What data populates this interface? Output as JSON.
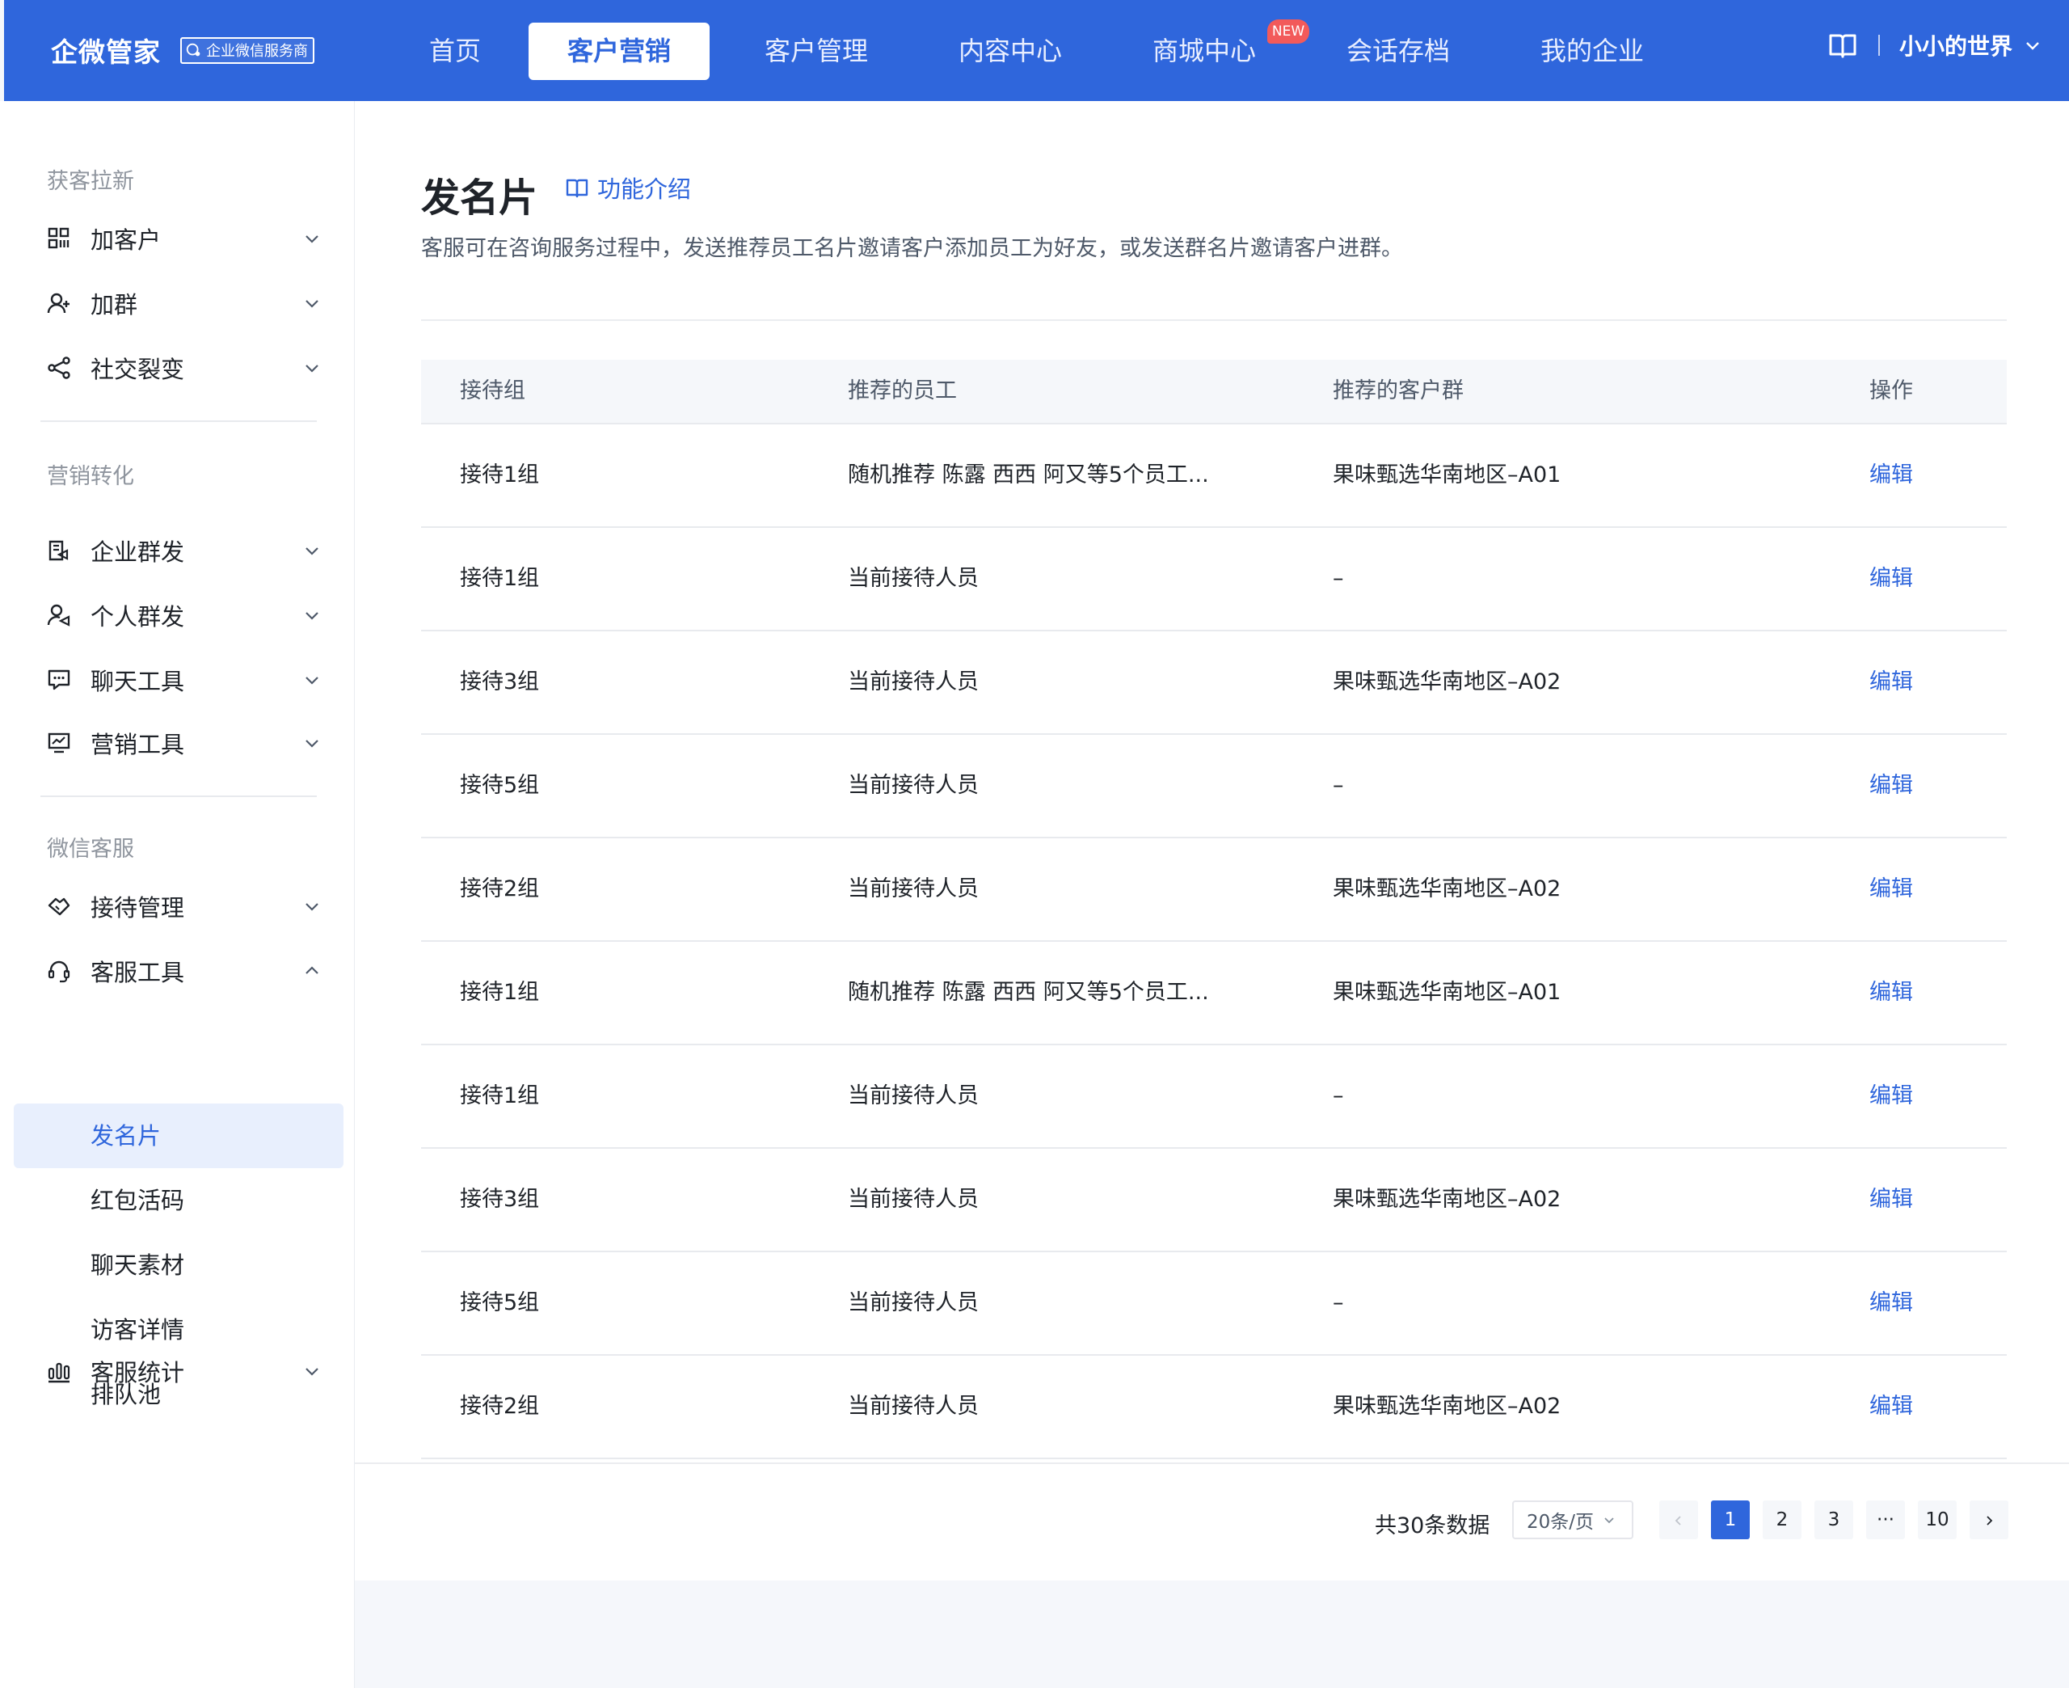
{
  "brand": {
    "name": "企微管家",
    "badge": "企业微信服务商"
  },
  "nav": {
    "items": [
      {
        "label": "首页"
      },
      {
        "label": "客户营销"
      },
      {
        "label": "客户管理"
      },
      {
        "label": "内容中心"
      },
      {
        "label": "商城中心"
      },
      {
        "label": "会话存档"
      },
      {
        "label": "我的企业"
      }
    ],
    "active": "客户营销",
    "new_badge": "NEW",
    "user": "小小的世界"
  },
  "sidebar": {
    "sections": [
      {
        "title": "获客拉新",
        "items": [
          {
            "label": "加客户"
          },
          {
            "label": "加群"
          },
          {
            "label": "社交裂变"
          }
        ]
      },
      {
        "title": "营销转化",
        "items": [
          {
            "label": "企业群发"
          },
          {
            "label": "个人群发"
          },
          {
            "label": "聊天工具"
          },
          {
            "label": "营销工具"
          }
        ]
      },
      {
        "title": "微信客服",
        "items": [
          {
            "label": "接待管理"
          },
          {
            "label": "客服工具"
          }
        ]
      }
    ],
    "sub_items": [
      {
        "label": "发名片"
      },
      {
        "label": "红包活码"
      },
      {
        "label": "聊天素材"
      },
      {
        "label": "访客详情"
      },
      {
        "label": "排队池"
      }
    ],
    "last_item": {
      "label": "客服统计"
    },
    "active_sub": "发名片"
  },
  "main": {
    "title": "发名片",
    "intro_link": "功能介绍",
    "description": "客服可在咨询服务过程中，发送推荐员工名片邀请客户添加员工为好友，或发送群名片邀请客户进群。"
  },
  "table": {
    "columns": [
      "接待组",
      "推荐的员工",
      "推荐的客户群",
      "操作"
    ],
    "rows": [
      {
        "group": "接待1组",
        "staff": "随机推荐 陈露 西西 阿又等5个员工...",
        "chat": "果味甄选华南地区–A01",
        "action": "编辑"
      },
      {
        "group": "接待1组",
        "staff": "当前接待人员",
        "chat": "–",
        "action": "编辑"
      },
      {
        "group": "接待3组",
        "staff": "当前接待人员",
        "chat": "果味甄选华南地区–A02",
        "action": "编辑"
      },
      {
        "group": "接待5组",
        "staff": "当前接待人员",
        "chat": "–",
        "action": "编辑"
      },
      {
        "group": "接待2组",
        "staff": "当前接待人员",
        "chat": "果味甄选华南地区–A02",
        "action": "编辑"
      },
      {
        "group": "接待1组",
        "staff": "随机推荐 陈露 西西 阿又等5个员工...",
        "chat": "果味甄选华南地区–A01",
        "action": "编辑"
      },
      {
        "group": "接待1组",
        "staff": "当前接待人员",
        "chat": "–",
        "action": "编辑"
      },
      {
        "group": "接待3组",
        "staff": "当前接待人员",
        "chat": "果味甄选华南地区–A02",
        "action": "编辑"
      },
      {
        "group": "接待5组",
        "staff": "当前接待人员",
        "chat": "–",
        "action": "编辑"
      },
      {
        "group": "接待2组",
        "staff": "当前接待人员",
        "chat": "果味甄选华南地区–A02",
        "action": "编辑"
      }
    ]
  },
  "pagination": {
    "total": "共30条数据",
    "page_size": "20条/页",
    "pages": [
      "1",
      "2",
      "3",
      "···",
      "10"
    ],
    "current": "1"
  },
  "colors": {
    "primary": "#2f66dc",
    "new_badge": "#f25a5a",
    "active_bg": "#e8effd"
  }
}
